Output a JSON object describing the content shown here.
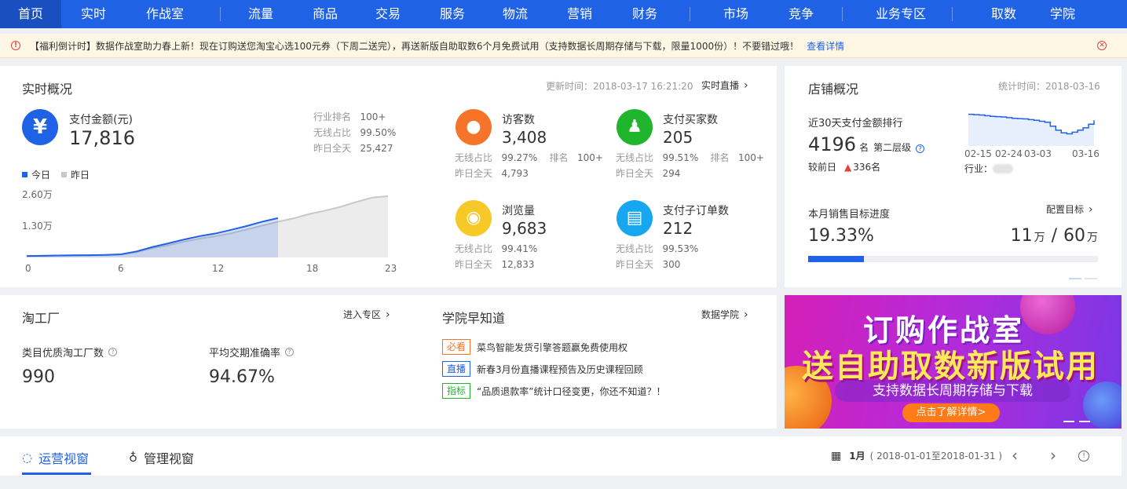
{
  "nav": {
    "items": [
      "首页",
      "实时",
      "作战室",
      "流量",
      "商品",
      "交易",
      "服务",
      "物流",
      "营销",
      "财务",
      "市场",
      "竞争",
      "业务专区",
      "取数",
      "学院"
    ],
    "active_index": 0,
    "bg_color": "#2062e6"
  },
  "notice": {
    "text": "【福利倒计时】数据作战室助力春上新！现在订购送您淘宝心选100元券（下周二送完），再送新版自助取数6个月免费试用（支持数据长周期存储与下载，限量1000份）！不要错过哦！",
    "link": "查看详情"
  },
  "realtime": {
    "title": "实时概况",
    "update_time": "更新时间：2018-03-17 16:21:20",
    "live_link": "实时直播",
    "pay_amount": {
      "label": "支付金额(元)",
      "value": "17,816",
      "rank_label": "行业排名",
      "rank_value": "100+",
      "wireless_label": "无线占比",
      "wireless_value": "99.50%",
      "yesterday_label": "昨日全天",
      "yesterday_value": "25,427"
    },
    "legend_today": "今日",
    "legend_yesterday": "昨日",
    "metrics": [
      {
        "label": "访客数",
        "value": "3,408",
        "wireless_label": "无线占比",
        "wireless": "99.27%",
        "rank_label": "排名",
        "rank": "100+",
        "yesterday_label": "昨日全天",
        "yesterday": "4,793",
        "icon": "footprint-icon",
        "color": "#f5742a"
      },
      {
        "label": "支付买家数",
        "value": "205",
        "wireless_label": "无线占比",
        "wireless": "99.51%",
        "rank_label": "排名",
        "rank": "100+",
        "yesterday_label": "昨日全天",
        "yesterday": "294",
        "icon": "users-icon",
        "color": "#1fb52c"
      },
      {
        "label": "浏览量",
        "value": "9,683",
        "wireless_label": "无线占比",
        "wireless": "99.41%",
        "yesterday_label": "昨日全天",
        "yesterday": "12,833",
        "icon": "eye-icon",
        "color": "#f7c928"
      },
      {
        "label": "支付子订单数",
        "value": "212",
        "wireless_label": "无线占比",
        "wireless": "99.53%",
        "yesterday_label": "昨日全天",
        "yesterday": "300",
        "icon": "clipboard-icon",
        "color": "#17a7f0"
      }
    ]
  },
  "chart_data": {
    "type": "area",
    "x_ticks": [
      "0",
      "6",
      "12",
      "18",
      "23"
    ],
    "y_ticks": [
      "2.60万",
      "1.30万"
    ],
    "ylim": [
      0,
      26000
    ],
    "x": [
      0,
      1,
      2,
      3,
      4,
      5,
      6,
      7,
      8,
      9,
      10,
      11,
      12,
      13,
      14,
      15,
      16,
      17,
      18,
      19,
      20,
      21,
      22,
      23
    ],
    "series": [
      {
        "name": "昨日",
        "values": [
          600,
          700,
          800,
          900,
          950,
          1000,
          1200,
          2200,
          3800,
          5000,
          6500,
          7800,
          8800,
          10000,
          11600,
          13200,
          14800,
          16200,
          18000,
          19400,
          21000,
          23000,
          24800,
          25400
        ],
        "color": "#c8c8c8"
      },
      {
        "name": "今日",
        "values": [
          600,
          700,
          800,
          900,
          950,
          1050,
          1300,
          2500,
          4300,
          5800,
          7400,
          8800,
          9900,
          11400,
          13000,
          14800,
          16300
        ],
        "color": "#2062e6"
      }
    ]
  },
  "store": {
    "title": "店铺概况",
    "stat_time": "统计时间：2018-03-16",
    "rank_label": "近30天支付金额排行",
    "rank_value": "4196",
    "rank_unit": "名",
    "level": "第二层级",
    "compare_label": "较前日",
    "compare_value": "336名",
    "industry_label": "行业：",
    "spark_ticks": [
      "02-15",
      "02-24",
      "03-03",
      "03-16"
    ],
    "spark_values": [
      96,
      95,
      94,
      92,
      90,
      89,
      88,
      86,
      84,
      83,
      82,
      80,
      78,
      75,
      72,
      60,
      48,
      40,
      37,
      42,
      48,
      55,
      66,
      78
    ],
    "target_label": "本月销售目标进度",
    "target_link": "配置目标",
    "target_percent": "19.33%",
    "target_fraction": 0.1933,
    "target_current": "11",
    "target_total": "60",
    "target_unit": "万",
    "target_sep": "/"
  },
  "taogongchang": {
    "title": "淘工厂",
    "link": "进入专区",
    "m1_label": "类目优质淘工厂数",
    "m1_value": "990",
    "m2_label": "平均交期准确率",
    "m2_value": "94.67%"
  },
  "academy": {
    "title": "学院早知道",
    "link": "数据学院",
    "news": [
      {
        "tag": "必看",
        "text": "菜鸟智能发货引擎答题赢免费使用权",
        "color": "#f5742a"
      },
      {
        "tag": "直播",
        "text": "新春3月份直播课程预告及历史课程回顾",
        "color": "#2062e6"
      },
      {
        "tag": "指标",
        "text": "“品质退款率”统计口径变更，你还不知道？！",
        "color": "#1fb52c"
      }
    ]
  },
  "banner": {
    "line1": "订购作战室",
    "line2": "送自助取数新版试用",
    "line3": "支持数据长周期存储与下载",
    "button": "点击了解详情>"
  },
  "tabs": {
    "items": [
      "运营视窗",
      "管理视窗"
    ],
    "active_index": 0,
    "period": "1月",
    "range": "( 2018-01-01至2018-01-31 )"
  }
}
